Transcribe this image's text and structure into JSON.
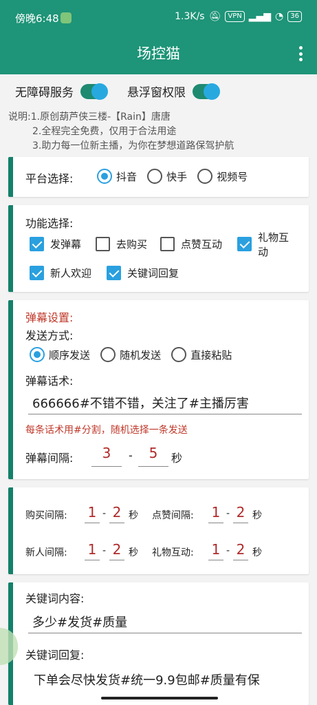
{
  "status_bar": {
    "time": "傍晚6:48",
    "speed": "1.3K/s",
    "vpn": "VPN",
    "battery": "36"
  },
  "app_bar": {
    "title": "场控猫"
  },
  "toggles": {
    "accessibility": "无障碍服务",
    "overlay": "悬浮窗权限"
  },
  "description": [
    "说明:1.原创葫芦侠三楼-【Rain】唐唐",
    "2.全程完全免费，仅用于合法用途",
    "3.助力每一位新主播，为你在梦想道路保驾护航"
  ],
  "platform": {
    "label": "平台选择:",
    "options": [
      "抖音",
      "快手",
      "视频号"
    ],
    "selected": "抖音"
  },
  "features": {
    "label": "功能选择:",
    "items": [
      {
        "label": "发弹幕",
        "checked": true
      },
      {
        "label": "去购买",
        "checked": false
      },
      {
        "label": "点赞互动",
        "checked": false
      },
      {
        "label": "礼物互动",
        "checked": true
      },
      {
        "label": "新人欢迎",
        "checked": true
      },
      {
        "label": "关键词回复",
        "checked": true
      }
    ]
  },
  "danmu": {
    "title": "弹幕设置:",
    "send_mode_label": "发送方式:",
    "send_modes": [
      "顺序发送",
      "随机发送",
      "直接粘贴"
    ],
    "send_mode_selected": "顺序发送",
    "script_label": "弹幕话术:",
    "script_value": "666666#不错不错，关注了#主播厉害",
    "hint": "每条话术用#分割，随机选择一条发送",
    "interval_label": "弹幕间隔:",
    "interval_min": "3",
    "interval_max": "5",
    "unit": "秒"
  },
  "intervals": {
    "dash": "-",
    "unit": "秒",
    "buy": {
      "label": "购买间隔:",
      "min": "1",
      "max": "2"
    },
    "like": {
      "label": "点赞间隔:",
      "min": "1",
      "max": "2"
    },
    "newcomer": {
      "label": "新人间隔:",
      "min": "1",
      "max": "2"
    },
    "gift": {
      "label": "礼物互动:",
      "min": "1",
      "max": "2"
    }
  },
  "keywords": {
    "content_label": "关键词内容:",
    "content_value": "多少#发货#质量",
    "reply_label": "关键词回复:",
    "reply_value": "下单会尽快发货#统一9.9包邮#质量有保"
  },
  "colors": {
    "primary": "#1e9478",
    "accent": "#2aa0df",
    "card_bar": "#14806a",
    "red": "#c0392b"
  }
}
